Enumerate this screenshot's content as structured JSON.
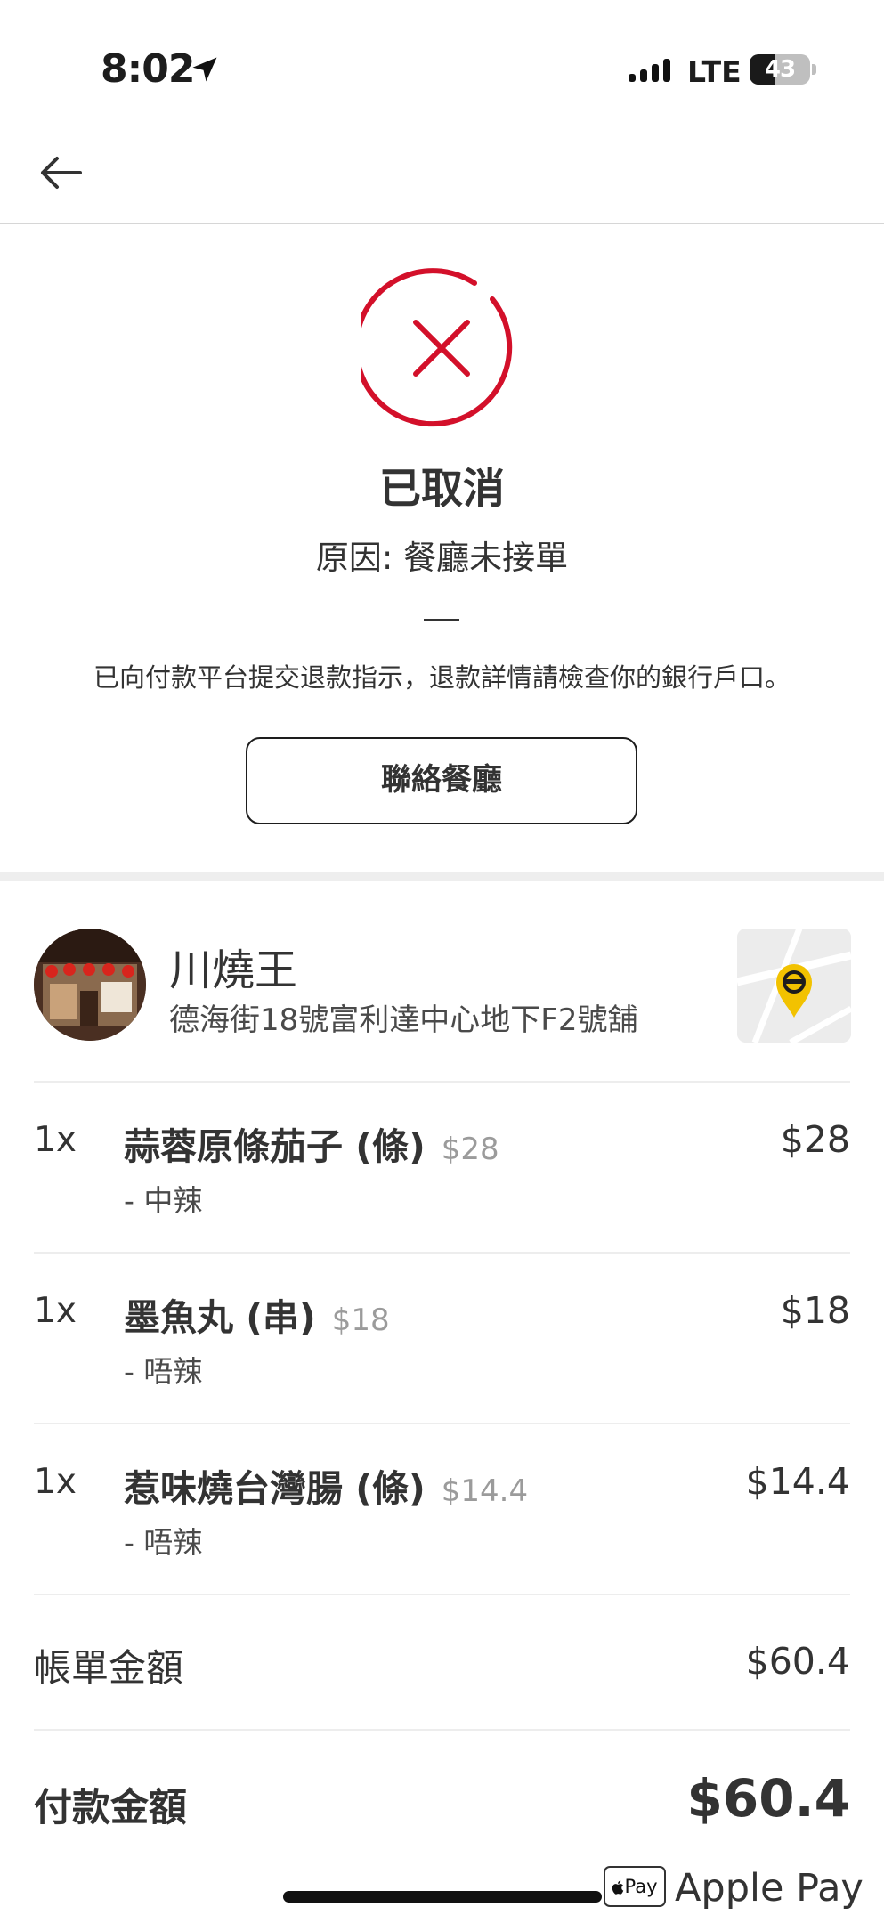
{
  "status_bar": {
    "time": "8:02",
    "network": "LTE",
    "battery": "43",
    "battery_level": 0.43
  },
  "order": {
    "status_title": "已取消",
    "reason": "原因: 餐廳未接單",
    "divider": "—",
    "refund_note": "已向付款平台提交退款指示，退款詳情請檢查你的銀行戶口。",
    "contact_button": "聯絡餐廳"
  },
  "restaurant": {
    "name": "川燒王",
    "address": "德海街18號富利達中心地下F2號舖"
  },
  "items": [
    {
      "qty": "1x",
      "name": "蒜蓉原條茄子 (條)",
      "unit_price": "$28",
      "price": "$28",
      "option": "- 中辣"
    },
    {
      "qty": "1x",
      "name": "墨魚丸 (串)",
      "unit_price": "$18",
      "price": "$18",
      "option": "- 唔辣"
    },
    {
      "qty": "1x",
      "name": "惹味燒台灣腸 (條)",
      "unit_price": "$14.4",
      "price": "$14.4",
      "option": "- 唔辣"
    }
  ],
  "summary": {
    "bill_label": "帳單金額",
    "bill_amount": "$60.4",
    "pay_label": "付款金額",
    "pay_amount": "$60.4",
    "pay_method_badge": "Pay",
    "pay_method": "Apple Pay"
  },
  "colors": {
    "cancel_red": "#d3102a",
    "map_pin": "#f2c200"
  },
  "icons": [
    "back-arrow-icon",
    "location-arrow-icon",
    "signal-icon",
    "cancel-x-icon",
    "map-pin-icon",
    "apple-logo-icon"
  ]
}
